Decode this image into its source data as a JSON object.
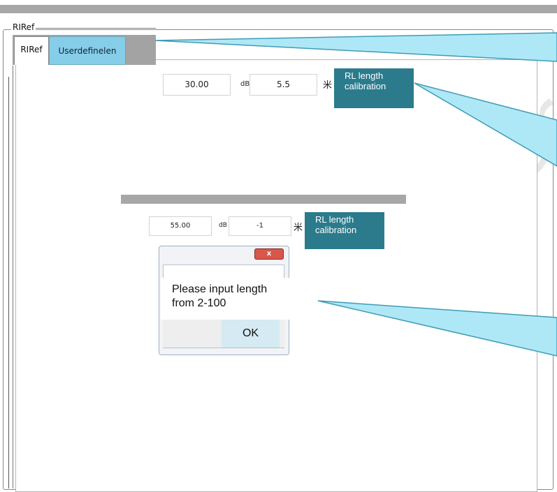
{
  "group": {
    "caption": "RIRef"
  },
  "tabs": [
    {
      "label": "RIRef",
      "selected": false
    },
    {
      "label": "Userdefinelen",
      "selected": true
    }
  ],
  "row1": {
    "db_value": "30.00",
    "db_unit": "dB",
    "length_value": "5.5",
    "length_unit": "米",
    "button_label": "RL length calibration"
  },
  "row2": {
    "db_value": "55.00",
    "db_unit": "dB",
    "length_value": "-1",
    "length_unit": "米",
    "button_label": "RL length calibration"
  },
  "dialog": {
    "close_glyph": "x",
    "message": "Please input length from 2-100",
    "ok_label": "OK"
  },
  "watermark": "www.Fiber-Mart",
  "colors": {
    "accent_button": "#2b7b8c",
    "selected_tab": "#86cde9",
    "callout": "#aee8f6",
    "close_button": "#d9574a"
  }
}
